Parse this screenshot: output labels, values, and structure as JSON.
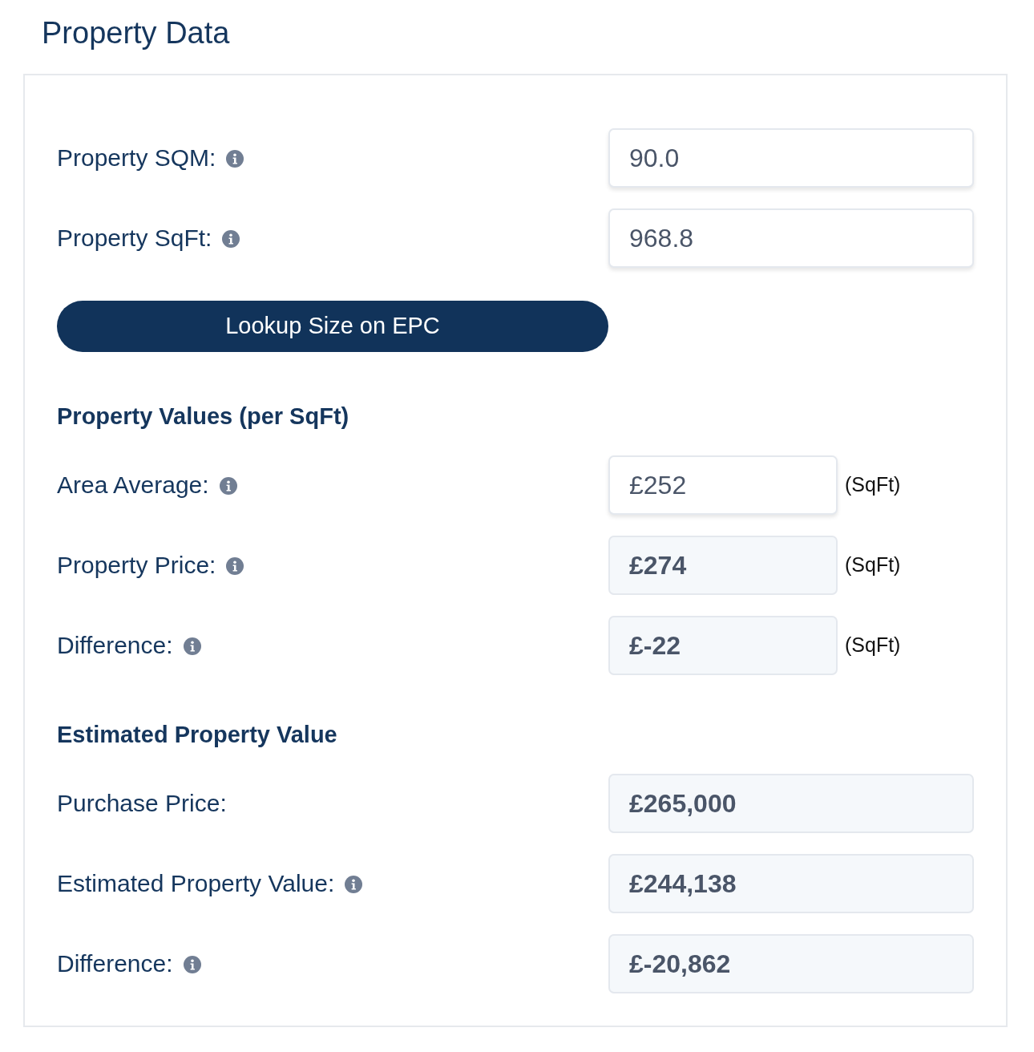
{
  "title": "Property Data",
  "items": [
    {
      "kind": "field",
      "label": "Property SQM:",
      "info": true,
      "value": "90.0",
      "readonly": false
    },
    {
      "kind": "field",
      "label": "Property SqFt:",
      "info": true,
      "value": "968.8",
      "readonly": false
    },
    {
      "kind": "button",
      "label": "Lookup Size on EPC"
    },
    {
      "kind": "heading",
      "label": "Property Values (per SqFt)"
    },
    {
      "kind": "field",
      "label": "Area Average:",
      "info": true,
      "value": "£252",
      "readonly": false,
      "unit": "(SqFt)"
    },
    {
      "kind": "field",
      "label": "Property Price:",
      "info": true,
      "value": "£274",
      "readonly": true,
      "unit": "(SqFt)"
    },
    {
      "kind": "field",
      "label": "Difference:",
      "info": true,
      "value": "£-22",
      "readonly": true,
      "unit": "(SqFt)"
    },
    {
      "kind": "heading",
      "label": "Estimated Property Value"
    },
    {
      "kind": "field",
      "label": "Purchase Price:",
      "info": false,
      "value": "£265,000",
      "readonly": true
    },
    {
      "kind": "field",
      "label": "Estimated Property Value:",
      "info": true,
      "value": "£244,138",
      "readonly": true
    },
    {
      "kind": "field",
      "label": "Difference:",
      "info": true,
      "value": "£-20,862",
      "readonly": true
    }
  ]
}
